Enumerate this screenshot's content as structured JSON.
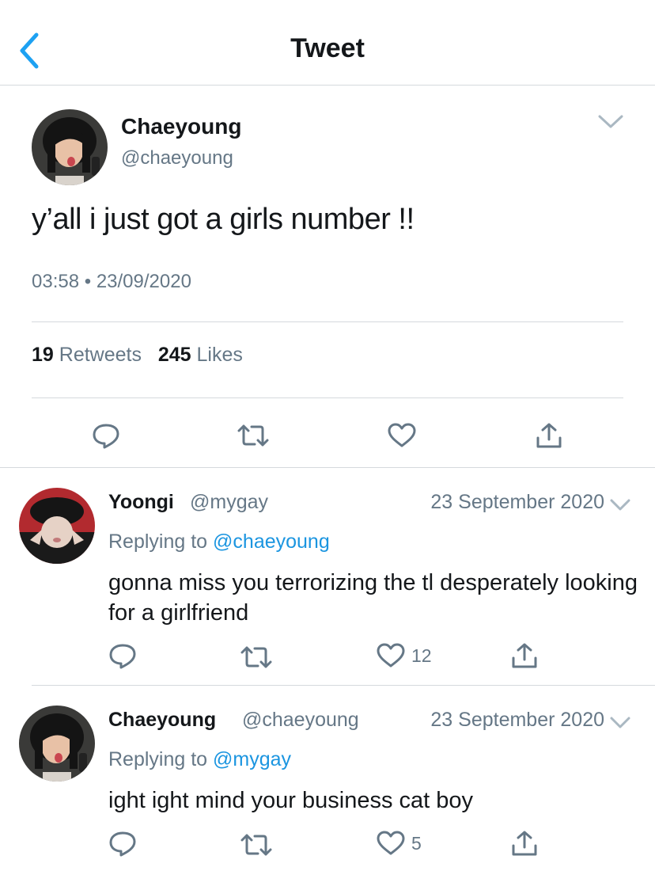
{
  "header": {
    "title": "Tweet",
    "back_icon": "chevron-left-icon",
    "accent": "#1da1f2"
  },
  "main_tweet": {
    "name": "Chaeyoung",
    "handle": "@chaeyoung",
    "text": "y’all i just got a girls number !!",
    "time": "03:58",
    "separator": "•",
    "date": "23/09/2020",
    "retweets_count": "19",
    "retweets_label": "Retweets",
    "likes_count": "245",
    "likes_label": "Likes",
    "actions": [
      "reply-icon",
      "retweet-icon",
      "like-icon",
      "share-icon"
    ]
  },
  "replies": [
    {
      "name": "Yoongi",
      "handle": "@mygay",
      "date": "23 September 2020",
      "replying_label": "Replying to",
      "replying_to": "@chaeyoung",
      "text": "gonna miss you terrorizing the tl desperately looking for a girlfriend",
      "like_count": "12"
    },
    {
      "name": "Chaeyoung",
      "handle": "@chaeyoung",
      "date": "23 September 2020",
      "replying_label": "Replying to",
      "replying_to": "@mygay",
      "text": "ight ight mind your business cat boy",
      "like_count": "5"
    }
  ],
  "colors": {
    "text": "#14171a",
    "secondary": "#657786",
    "link": "#1b95e0",
    "border": "#d5d9dd"
  }
}
